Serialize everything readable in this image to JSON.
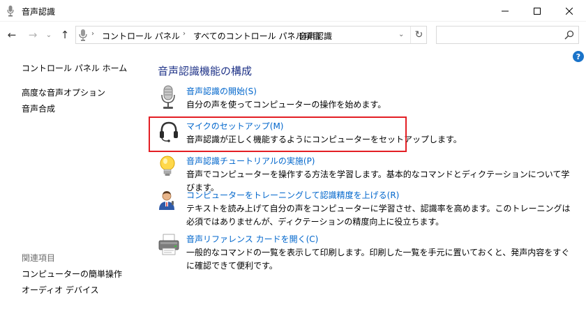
{
  "window": {
    "title": "音声認識",
    "minimize_glyph": "—",
    "maximize_glyph": "☐",
    "close_glyph": "✕"
  },
  "nav": {
    "back_glyph": "←",
    "forward_glyph": "→",
    "recent_glyph": "⌄",
    "up_glyph": "↑"
  },
  "address": {
    "crumbs": [
      "コントロール パネル",
      "すべてのコントロール パネル項目",
      "音声認識"
    ],
    "separator": "›",
    "dropdown_glyph": "⌄",
    "refresh_glyph": "↻"
  },
  "search": {
    "value": "",
    "placeholder": ""
  },
  "help_glyph": "?",
  "sidebar": {
    "home_label": "コントロール パネル ホーム",
    "links": [
      "高度な音声オプション",
      "音声合成"
    ],
    "related_heading": "関連項目",
    "related_links": [
      "コンピューターの簡単操作",
      "オーディオ デバイス"
    ]
  },
  "main": {
    "title": "音声認識機能の構成",
    "tasks": [
      {
        "icon": "microphone-icon",
        "link": "音声認識の開始(S)",
        "desc": "自分の声を使ってコンピューターの操作を始めます。"
      },
      {
        "icon": "headset-icon",
        "link": "マイクのセットアップ(M)",
        "desc": "音声認識が正しく機能するようにコンピューターをセットアップします。"
      },
      {
        "icon": "lightbulb-icon",
        "link": "音声認識チュートリアルの実施(P)",
        "desc": "音声でコンピューターを操作する方法を学習します。基本的なコマンドとディクテーションについて学びます。"
      },
      {
        "icon": "user-speaking-icon",
        "link": "コンピューターをトレーニングして認識精度を上げる(R)",
        "desc": "テキストを読み上げて自分の声をコンピューターに学習させ、認識率を高めます。このトレーニングは必須ではありませんが、ディクテーションの精度向上に役立ちます。"
      },
      {
        "icon": "printer-icon",
        "link": "音声リファレンス カードを開く(C)",
        "desc": "一般的なコマンドの一覧を表示して印刷します。印刷した一覧を手元に置いておくと、発声内容をすぐに確認できて便利です。"
      }
    ]
  },
  "colors": {
    "link": "#0066cc",
    "title": "#1e3287",
    "highlight": "#e31e24"
  }
}
